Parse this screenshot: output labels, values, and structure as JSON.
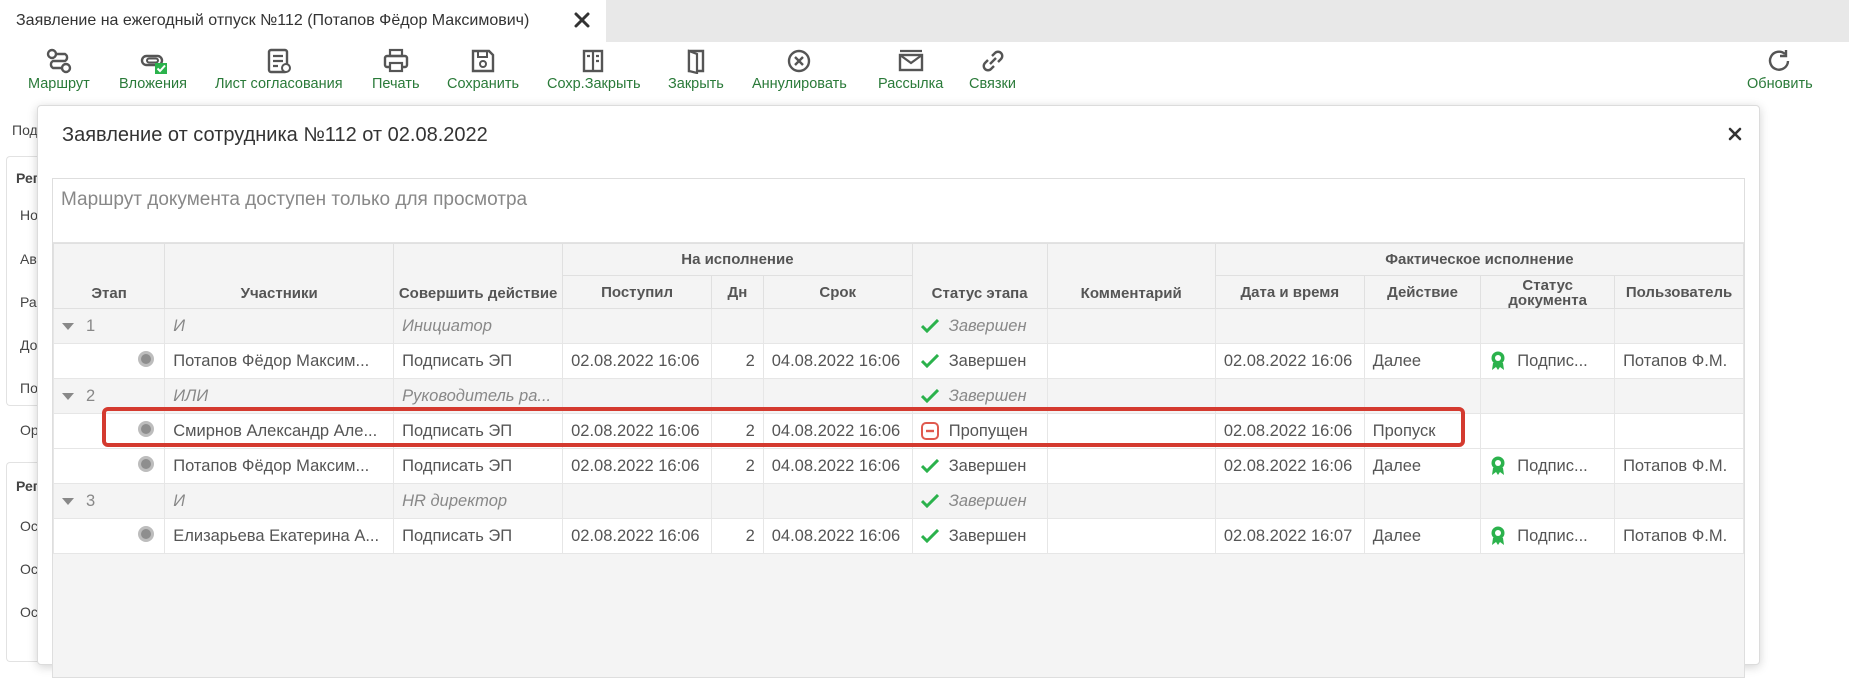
{
  "tab": {
    "title": "Заявление на ежегодный отпуск №112 (Потапов Фёдор Максимович)"
  },
  "toolbar": {
    "route": "Маршрут",
    "attachments": "Вложения",
    "approval_sheet": "Лист согласования",
    "print": "Печать",
    "save": "Сохранить",
    "save_close": "Сохр.Закрыть",
    "close": "Закрыть",
    "annul": "Аннулировать",
    "mailing": "Рассылка",
    "links": "Связки",
    "refresh": "Обновить"
  },
  "background": {
    "labels": [
      "Под",
      "Рег",
      "Но",
      "Ав",
      "Ра",
      "До",
      "По",
      "Ор",
      "Рег",
      "Ос",
      "Ос",
      "Ос"
    ]
  },
  "modal": {
    "title": "Заявление от сотрудника №112 от 02.08.2022",
    "caption": "Маршрут документа доступен только для просмотра"
  },
  "table": {
    "group_headers": {
      "execution": "На исполнение",
      "actual": "Фактическое исполнение"
    },
    "headers": {
      "stage": "Этап",
      "participants": "Участники",
      "action": "Совершить действие",
      "received": "Поступил",
      "days": "Дн",
      "deadline": "Срок",
      "stage_status": "Статус этапа",
      "comment": "Комментарий",
      "datetime": "Дата и время",
      "fact_action": "Действие",
      "doc_status": "Статус документа",
      "user": "Пользователь"
    },
    "rows": [
      {
        "type": "group",
        "stage": "1",
        "participant": "И",
        "action": "Инициатор",
        "status": "Завершен"
      },
      {
        "type": "item",
        "participant": "Потапов Фёдор Максим...",
        "action": "Подписать ЭП",
        "received": "02.08.2022 16:06",
        "days": "2",
        "deadline": "04.08.2022 16:06",
        "status": "Завершен",
        "status_kind": "done",
        "datetime": "02.08.2022 16:06",
        "fact_action": "Далее",
        "doc_status": "Подпис...",
        "user": "Потапов Ф.М."
      },
      {
        "type": "group",
        "stage": "2",
        "participant": "ИЛИ",
        "action": "Руководитель ра...",
        "status": "Завершен"
      },
      {
        "type": "item",
        "participant": "Смирнов Александр Але...",
        "action": "Подписать ЭП",
        "received": "02.08.2022 16:06",
        "days": "2",
        "deadline": "04.08.2022 16:06",
        "status": "Пропущен",
        "status_kind": "skipped",
        "datetime": "02.08.2022 16:06",
        "fact_action": "Пропуск",
        "doc_status": "",
        "user": ""
      },
      {
        "type": "item",
        "participant": "Потапов Фёдор Максим...",
        "action": "Подписать ЭП",
        "received": "02.08.2022 16:06",
        "days": "2",
        "deadline": "04.08.2022 16:06",
        "status": "Завершен",
        "status_kind": "done",
        "datetime": "02.08.2022 16:06",
        "fact_action": "Далее",
        "doc_status": "Подпис...",
        "user": "Потапов Ф.М."
      },
      {
        "type": "group",
        "stage": "3",
        "participant": "И",
        "action": "HR директор",
        "status": "Завершен"
      },
      {
        "type": "item",
        "participant": "Елизарьева Екатерина А...",
        "action": "Подписать ЭП",
        "received": "02.08.2022 16:06",
        "days": "2",
        "deadline": "04.08.2022 16:06",
        "status": "Завершен",
        "status_kind": "done",
        "datetime": "02.08.2022 16:07",
        "fact_action": "Далее",
        "doc_status": "Подпис...",
        "user": "Потапов Ф.М."
      }
    ]
  },
  "colors": {
    "accent_green": "#2a7a39",
    "check_green": "#2bb24c",
    "skip_red": "#e05a4f",
    "highlight": "#d43a2f"
  }
}
